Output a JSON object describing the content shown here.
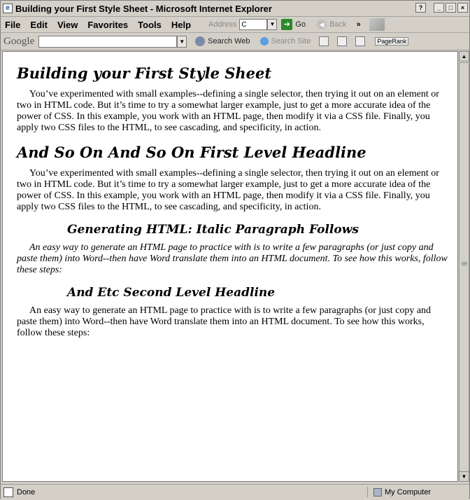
{
  "window": {
    "title": "Building your First Style Sheet - Microsoft Internet Explorer"
  },
  "menu": {
    "items": [
      "File",
      "Edit",
      "View",
      "Favorites",
      "Tools",
      "Help"
    ]
  },
  "address": {
    "label": "Address",
    "value": "C"
  },
  "go_label": "Go",
  "back_label": "Back",
  "google_toolbar": {
    "logo": "Google",
    "search_web_label": "Search Web",
    "search_site_label": "Search Site",
    "pagerank_label": "PageRank"
  },
  "page": {
    "h1_1": "Building your First Style Sheet",
    "p1": "You’ve experimented with small examples--defining a single selector, then trying it out on an element or two in HTML code. But it’s time to try a somewhat larger example, just to get a more accurate idea of the power of CSS. In this example, you work with an HTML page, then modify it via a CSS file. Finally, you apply two CSS files to the HTML, to see cascading, and specificity, in action.",
    "h1_2": "And So On And So On First Level Headline",
    "p2": "You’ve experimented with small examples--defining a single selector, then trying it out on an element or two in HTML code. But it’s time to try a somewhat larger example, just to get a more accurate idea of the power of CSS. In this example, you work with an HTML page, then modify it via a CSS file. Finally, you apply two CSS files to the HTML, to see cascading, and specificity, in action.",
    "h2_1": "Generating HTML: Italic Paragraph Follows",
    "p3": "An easy way to generate an HTML page to practice with is to write a few paragraphs (or just copy and paste them) into Word--then have Word translate them into an HTML document. To see how this works, follow these steps:",
    "h2_2": "And Etc Second Level Headline",
    "p4": "An easy way to generate an HTML page to practice with is to write a few paragraphs (or just copy and paste them) into Word--then have Word translate them into an HTML document. To see how this works, follow these steps:"
  },
  "status": {
    "left": "Done",
    "zone": "My Computer"
  }
}
